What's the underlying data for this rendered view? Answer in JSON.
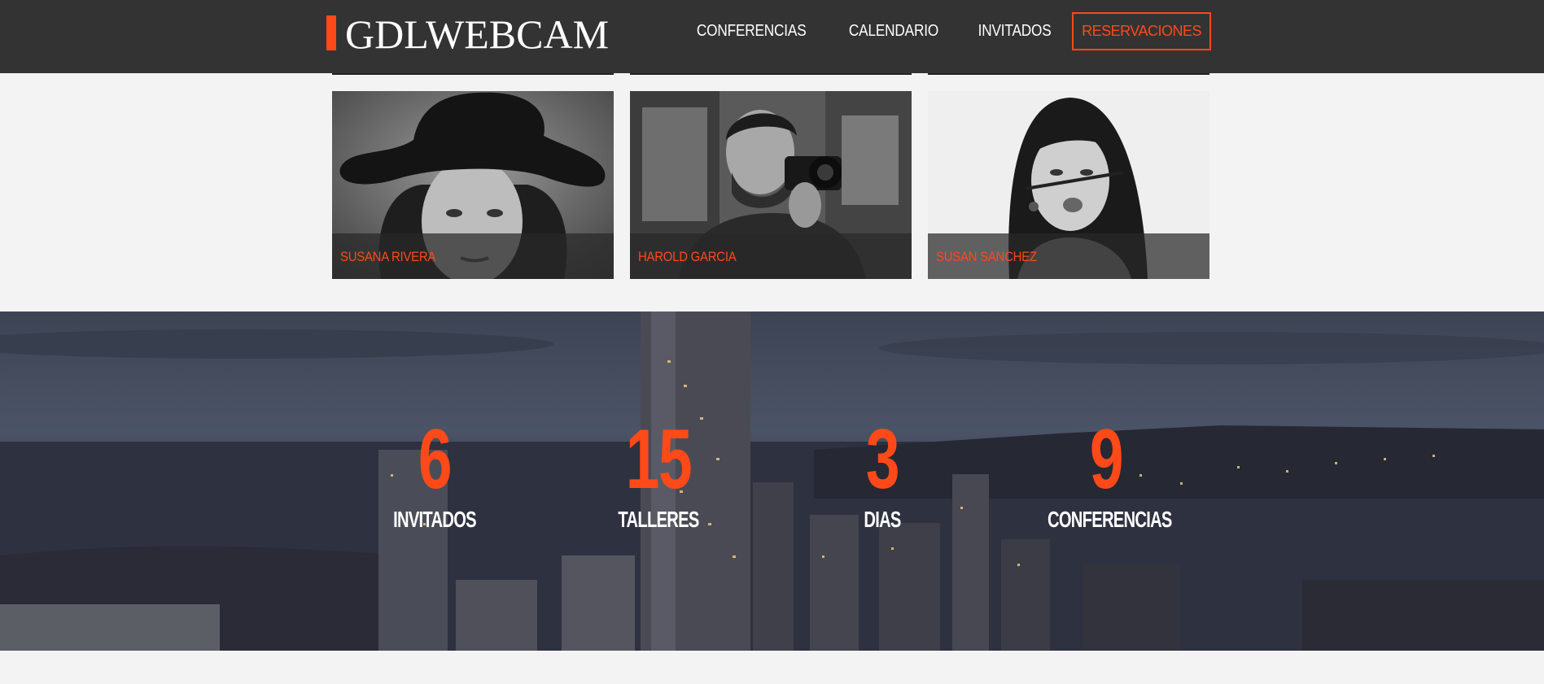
{
  "header": {
    "logo": "GDLWEBCAM",
    "nav": {
      "conferencias": "CONFERENCIAS",
      "calendario": "CALENDARIO",
      "invitados": "INVITADOS",
      "reservaciones": "RESERVACIONES"
    }
  },
  "guests": [
    {
      "name": "SUSANA RIVERA"
    },
    {
      "name": "HAROLD GARCIA"
    },
    {
      "name": "SUSAN SANCHEZ"
    }
  ],
  "stats": [
    {
      "number": "6",
      "label": "INVITADOS"
    },
    {
      "number": "15",
      "label": "TALLERES"
    },
    {
      "number": "3",
      "label": "DIAS"
    },
    {
      "number": "9",
      "label": "CONFERENCIAS"
    }
  ],
  "colors": {
    "accent": "#fe4918",
    "header_bg": "#333333",
    "page_bg": "#f3f3f3"
  }
}
